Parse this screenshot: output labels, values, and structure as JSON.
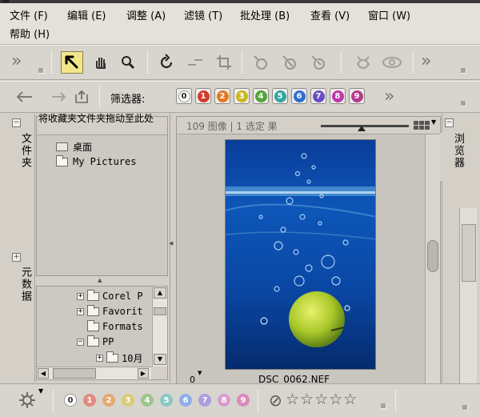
{
  "menu": {
    "items": [
      "文件 (F)",
      "编辑 (E)",
      "调整 (A)",
      "滤镜 (T)",
      "批处理 (B)",
      "查看 (V)",
      "窗口 (W)",
      "帮助 (H)"
    ]
  },
  "nav_toolbar": {
    "filter_label": "筛选器:",
    "filters": [
      {
        "label": "0",
        "color": "#ffffff"
      },
      {
        "label": "1",
        "color": "#d23b2a"
      },
      {
        "label": "2",
        "color": "#e07a22"
      },
      {
        "label": "3",
        "color": "#c9b81f"
      },
      {
        "label": "4",
        "color": "#53a43a"
      },
      {
        "label": "5",
        "color": "#2fa6a1"
      },
      {
        "label": "6",
        "color": "#2d6fd0"
      },
      {
        "label": "7",
        "color": "#6a4fc0"
      },
      {
        "label": "8",
        "color": "#bb3aa8"
      },
      {
        "label": "9",
        "color": "#b23b8c"
      }
    ]
  },
  "left_tabs": {
    "folders": "文件夹",
    "metadata": "元数据"
  },
  "favorites": {
    "hint": "将收藏夹文件夹拖动至此处",
    "items": [
      "桌面",
      "My Pictures"
    ]
  },
  "tree": {
    "items": [
      "Corel P",
      "Favorit",
      "Formats",
      "PP",
      "10月"
    ]
  },
  "browser": {
    "status": "109 图像 | 1 选定 果",
    "tab_label": "浏览器",
    "thumbnail_rating": "0",
    "filename": "DSC_0062.NEF"
  },
  "bottom": {
    "labels": [
      "0",
      "1",
      "2",
      "3",
      "4",
      "5",
      "6",
      "7",
      "8",
      "9"
    ],
    "label_colors": [
      "#8a8a8a",
      "#e08a80",
      "#e6a870",
      "#d8cc78",
      "#9cc68e",
      "#8cc8c4",
      "#8eaee6",
      "#ac9ce0",
      "#d89cd0",
      "#d88aba"
    ],
    "stars": [
      "☆",
      "☆",
      "☆",
      "☆",
      "☆"
    ]
  },
  "colors": {
    "accent_active_tool": "#f3e58a",
    "panel_bg": "#d4d0c8"
  }
}
